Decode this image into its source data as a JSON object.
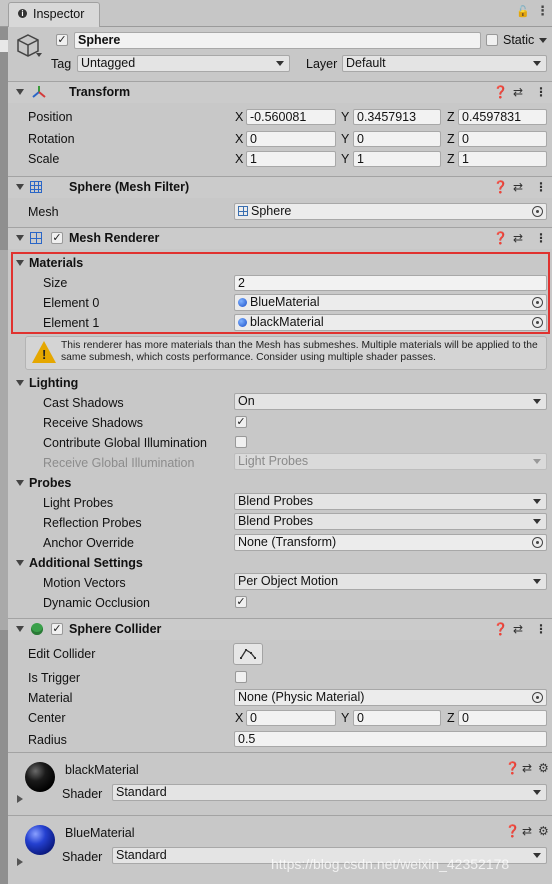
{
  "window": {
    "tab_title": "Inspector"
  },
  "object": {
    "name": "Sphere",
    "static_label": "Static",
    "tag_label": "Tag",
    "tag_value": "Untagged",
    "layer_label": "Layer",
    "layer_value": "Default"
  },
  "transform": {
    "title": "Transform",
    "rows": [
      {
        "label": "Position",
        "x": "-0.560081",
        "y": "0.3457913",
        "z": "0.4597831"
      },
      {
        "label": "Rotation",
        "x": "0",
        "y": "0",
        "z": "0"
      },
      {
        "label": "Scale",
        "x": "1",
        "y": "1",
        "z": "1"
      }
    ],
    "axis": {
      "x": "X",
      "y": "Y",
      "z": "Z"
    }
  },
  "mesh_filter": {
    "title": "Sphere (Mesh Filter)",
    "mesh_label": "Mesh",
    "mesh_value": "Sphere"
  },
  "mesh_renderer": {
    "title": "Mesh Renderer",
    "materials": {
      "label": "Materials",
      "size_label": "Size",
      "size_value": "2",
      "element0_label": "Element 0",
      "element0_value": "BlueMaterial",
      "element1_label": "Element 1",
      "element1_value": "blackMaterial"
    },
    "warning": "This renderer has more materials than the Mesh has submeshes. Multiple materials will be applied to the same submesh, which costs performance. Consider using multiple shader passes.",
    "lighting": {
      "label": "Lighting",
      "cast_shadows_label": "Cast Shadows",
      "cast_shadows_value": "On",
      "receive_shadows_label": "Receive Shadows",
      "contribute_gi_label": "Contribute Global Illumination",
      "receive_gi_label": "Receive Global Illumination",
      "receive_gi_value": "Light Probes"
    },
    "probes": {
      "label": "Probes",
      "light_probes_label": "Light Probes",
      "light_probes_value": "Blend Probes",
      "reflection_probes_label": "Reflection Probes",
      "reflection_probes_value": "Blend Probes",
      "anchor_override_label": "Anchor Override",
      "anchor_override_value": "None (Transform)"
    },
    "additional": {
      "label": "Additional Settings",
      "motion_vectors_label": "Motion Vectors",
      "motion_vectors_value": "Per Object Motion",
      "dynamic_occlusion_label": "Dynamic Occlusion"
    }
  },
  "sphere_collider": {
    "title": "Sphere Collider",
    "edit_collider_label": "Edit Collider",
    "is_trigger_label": "Is Trigger",
    "material_label": "Material",
    "material_value": "None (Physic Material)",
    "center_label": "Center",
    "center": {
      "x": "0",
      "y": "0",
      "z": "0"
    },
    "radius_label": "Radius",
    "radius_value": "0.5"
  },
  "materials_list": [
    {
      "name": "blackMaterial",
      "shader_label": "Shader",
      "shader_value": "Standard",
      "color": "#0a0a0a"
    },
    {
      "name": "BlueMaterial",
      "shader_label": "Shader",
      "shader_value": "Standard",
      "color": "#1a35b8"
    }
  ],
  "watermark": "https://blog.csdn.net/weixin_42352178",
  "colors": {
    "highlight_border": "#e0322f",
    "warning_icon": "#e5a700"
  },
  "icons": {
    "help": "help-icon",
    "preset": "preset-icon",
    "more": "more-vert-icon",
    "lock": "lock-icon",
    "menu": "more-vert-icon"
  }
}
